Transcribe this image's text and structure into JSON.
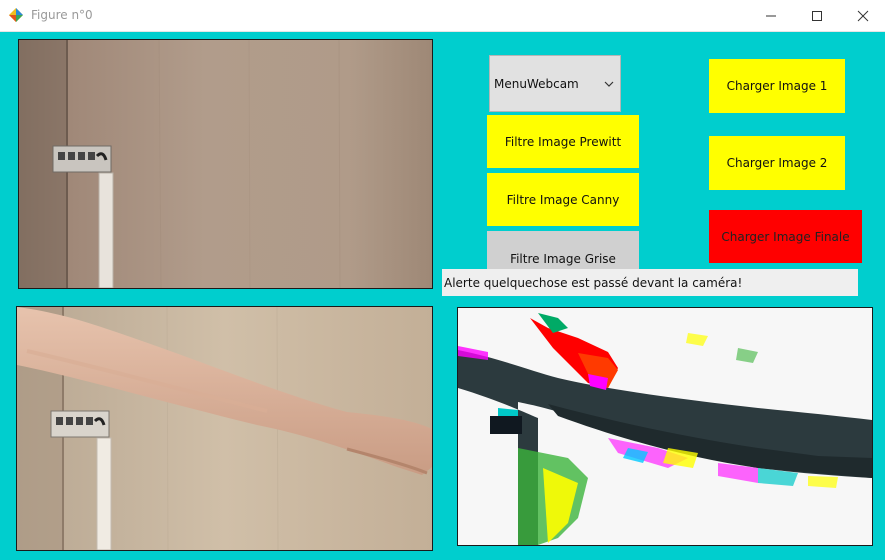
{
  "window": {
    "title": "Figure n°0",
    "icons": {
      "app": "matplotlib-logo-icon",
      "minimize": "minimize-icon",
      "maximize": "maximize-icon",
      "close": "close-icon"
    }
  },
  "controls": {
    "menu_webcam": {
      "label": "MenuWebcam",
      "icon": "chevron-down-icon"
    },
    "filtre_prewitt": "Filtre Image Prewitt",
    "filtre_canny": "Filtre Image Canny",
    "filtre_grise": "Filtre Image Grise",
    "charger_image_1": "Charger Image 1",
    "charger_image_2": "Charger Image 2",
    "charger_image_finale": "Charger Image Finale"
  },
  "alert": {
    "text": "Alerte quelquechose est passé devant la caméra!"
  },
  "colors": {
    "background": "#00cece",
    "button_yellow": "#ffff00",
    "button_red": "#ff0000",
    "button_grey": "#d0d0d0",
    "alert_bg": "#efefef"
  }
}
